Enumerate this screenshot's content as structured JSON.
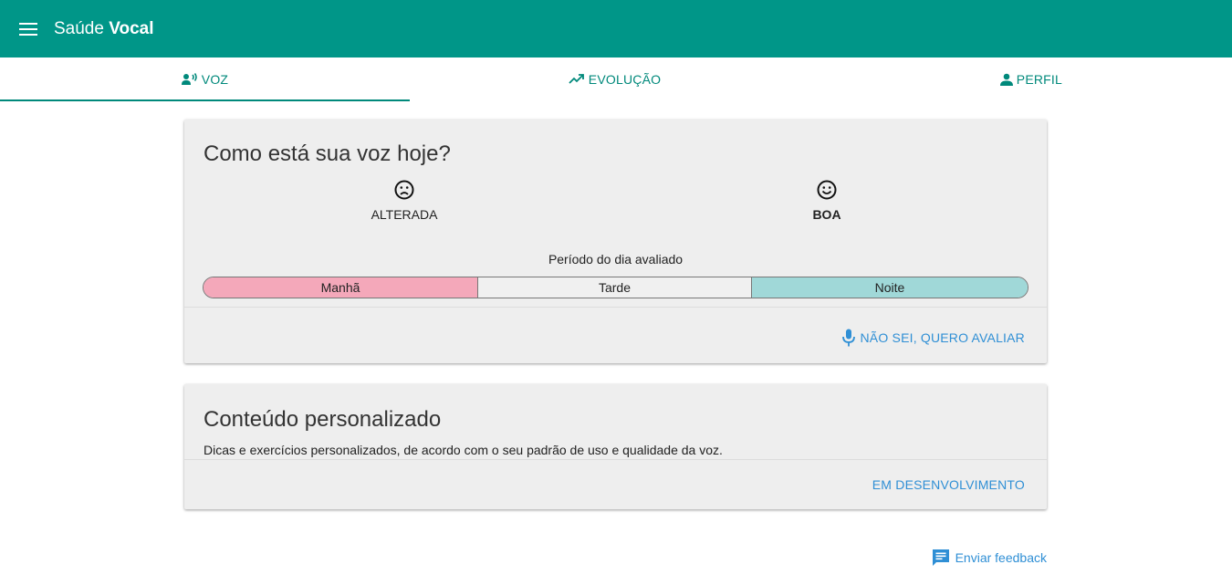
{
  "app": {
    "title_part1": "Saúde",
    "title_part2": "Vocal"
  },
  "tabs": [
    {
      "label": "VOZ",
      "icon": "voice-icon",
      "active": true
    },
    {
      "label": "EVOLUÇÃO",
      "icon": "trending-icon",
      "active": false
    },
    {
      "label": "PERFIL",
      "icon": "person-icon",
      "active": false
    }
  ],
  "voice_card": {
    "title": "Como está sua voz hoje?",
    "options": [
      {
        "label": "ALTERADA",
        "icon": "sad-face-icon"
      },
      {
        "label": "BOA",
        "icon": "happy-face-icon",
        "selected": true
      }
    ],
    "period_label": "Período do dia avaliado",
    "periods": [
      {
        "label": "Manhã",
        "color": "#f4a8ba"
      },
      {
        "label": "Tarde",
        "color": "#f0f0f0"
      },
      {
        "label": "Noite",
        "color": "#a0d8d8"
      }
    ],
    "action_label": "NÃO SEI, QUERO AVALIAR",
    "action_icon": "microphone-icon"
  },
  "content_card": {
    "title": "Conteúdo personalizado",
    "description": "Dicas e exercícios personalizados, de acordo com o seu padrão de uso e qualidade da voz.",
    "action_label": "EM DESENVOLVIMENTO"
  },
  "feedback": {
    "label": "Enviar feedback",
    "icon": "feedback-icon"
  },
  "colors": {
    "primary": "#009688",
    "accent": "#2f8fd5",
    "tab_text": "#00897b"
  }
}
